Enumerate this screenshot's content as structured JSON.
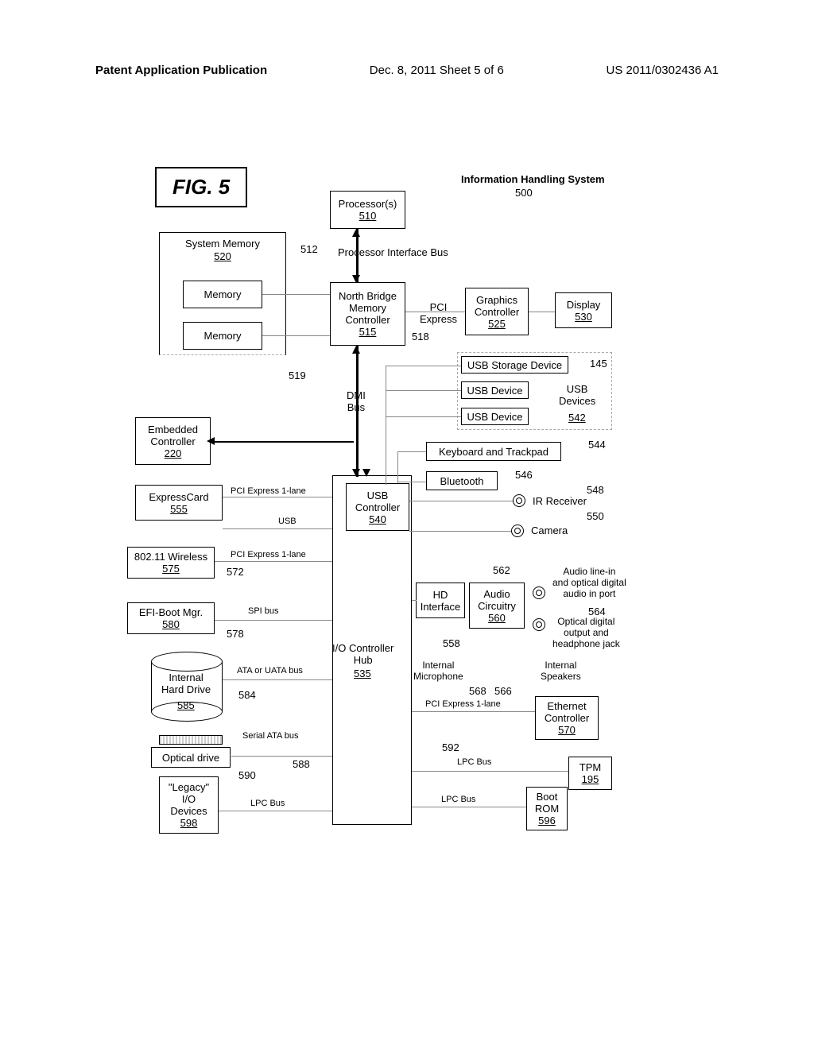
{
  "header": {
    "left": "Patent Application Publication",
    "center": "Dec. 8, 2011   Sheet 5 of 6",
    "right": "US 2011/0302436 A1"
  },
  "fig_title": "FIG. 5",
  "system_title": "Information Handling System",
  "system_ref": "500",
  "blocks": {
    "processors": {
      "label": "Processor(s)",
      "ref": "510"
    },
    "sys_memory": {
      "label": "System Memory",
      "ref": "520"
    },
    "memory1": {
      "label": "Memory"
    },
    "memory2": {
      "label": "Memory"
    },
    "north_bridge": {
      "label": "North Bridge\nMemory\nController",
      "ref": "515"
    },
    "graphics": {
      "label": "Graphics\nController",
      "ref": "525"
    },
    "display": {
      "label": "Display",
      "ref": "530"
    },
    "usb_storage": {
      "label": "USB Storage Device",
      "ref": "145"
    },
    "usb_device1": {
      "label": "USB Device"
    },
    "usb_device2": {
      "label": "USB Device"
    },
    "usb_devices_group": {
      "label": "USB\nDevices",
      "ref": "542"
    },
    "keyboard": {
      "label": "Keyboard and Trackpad",
      "ref": "544"
    },
    "bluetooth": {
      "label": "Bluetooth",
      "ref": "546"
    },
    "ir_receiver": {
      "label": "IR Receiver",
      "ref": "548"
    },
    "camera": {
      "label": "Camera",
      "ref": "550"
    },
    "embedded": {
      "label": "Embedded\nController",
      "ref": "220"
    },
    "expresscard": {
      "label": "ExpressCard",
      "ref": "555"
    },
    "wireless": {
      "label": "802.11 Wireless",
      "ref": "575"
    },
    "efi": {
      "label": "EFI-Boot Mgr.",
      "ref": "580"
    },
    "hard_drive": {
      "label": "Internal\nHard Drive",
      "ref": "585"
    },
    "optical": {
      "label": "Optical drive"
    },
    "legacy": {
      "label": "\"Legacy\"\nI/O\nDevices",
      "ref": "598"
    },
    "usb_controller": {
      "label": "USB\nController",
      "ref": "540"
    },
    "io_hub": {
      "label": "I/O Controller\nHub",
      "ref": "535"
    },
    "hd_interface": {
      "label": "HD\nInterface"
    },
    "audio": {
      "label": "Audio\nCircuitry",
      "ref": "560"
    },
    "internal_mic": {
      "label": "Internal\nMicrophone"
    },
    "audio_line_in": {
      "label": "Audio line-in\nand optical digital\naudio in port"
    },
    "optical_out": {
      "label": "Optical digital\noutput and\nheadphone jack"
    },
    "internal_speakers": {
      "label": "Internal\nSpeakers"
    },
    "ethernet": {
      "label": "Ethernet\nController",
      "ref": "570"
    },
    "tpm": {
      "label": "TPM",
      "ref": "195"
    },
    "boot_rom": {
      "label": "Boot\nROM",
      "ref": "596"
    }
  },
  "bus_labels": {
    "proc_bus": "Processor Interface Bus",
    "pci_express": "PCI\nExpress",
    "dmi_bus": "DMI\nBus",
    "pcie_1lane_1": "PCI Express 1-lane",
    "pcie_1lane_2": "PCI Express 1-lane",
    "usb_lane": "USB",
    "spi_bus": "SPI bus",
    "ata_bus": "ATA or UATA bus",
    "sata_bus": "Serial ATA bus",
    "lpc_bus_1": "LPC Bus",
    "lpc_bus_2": "LPC Bus",
    "lpc_bus_3": "LPC Bus",
    "pcie_1lane_3": "PCI Express 1-lane"
  },
  "refs": {
    "r512": "512",
    "r518": "518",
    "r519": "519",
    "r558": "558",
    "r562": "562",
    "r564": "564",
    "r566": "566",
    "r568": "568",
    "r572": "572",
    "r578": "578",
    "r584": "584",
    "r588": "588",
    "r590": "590",
    "r592": "592"
  }
}
